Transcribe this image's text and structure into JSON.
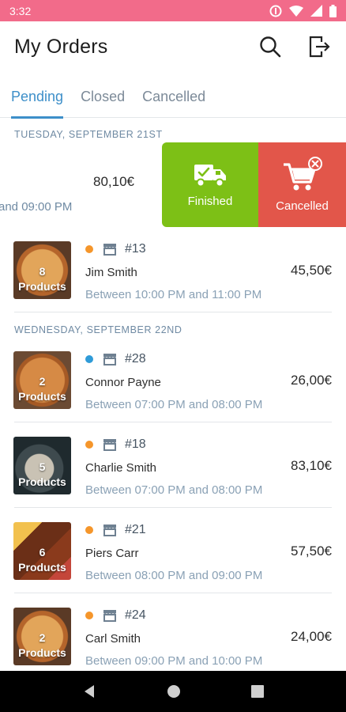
{
  "status_bar": {
    "time": "3:32"
  },
  "header": {
    "title": "My Orders"
  },
  "tabs": [
    {
      "label": "Pending",
      "active": true
    },
    {
      "label": "Closed",
      "active": false
    },
    {
      "label": "Cancelled",
      "active": false
    }
  ],
  "sections": [
    {
      "date": "TUESDAY, SEPTEMBER 21ST"
    },
    {
      "date": "WEDNESDAY, SEPTEMBER 22ND"
    }
  ],
  "swiped_order": {
    "price": "80,10€",
    "time": "and 09:00 PM",
    "actions": {
      "finished": "Finished",
      "cancelled": "Cancelled"
    }
  },
  "orders": [
    {
      "count": "8",
      "products_label": "Products",
      "number": "#13",
      "name": "Jim Smith",
      "time": "Between 10:00 PM and 11:00 PM",
      "price": "45,50€",
      "dot_color": "#f5962b"
    },
    {
      "count": "2",
      "products_label": "Products",
      "number": "#28",
      "name": "Connor Payne",
      "time": "Between 07:00 PM and 08:00 PM",
      "price": "26,00€",
      "dot_color": "#2f9bd8"
    },
    {
      "count": "5",
      "products_label": "Products",
      "number": "#18",
      "name": "Charlie Smith",
      "time": "Between 07:00 PM and 08:00 PM",
      "price": "83,10€",
      "dot_color": "#f5962b"
    },
    {
      "count": "6",
      "products_label": "Products",
      "number": "#21",
      "name": "Piers Carr",
      "time": "Between 08:00 PM and 09:00 PM",
      "price": "57,50€",
      "dot_color": "#f5962b"
    },
    {
      "count": "2",
      "products_label": "Products",
      "number": "#24",
      "name": "Carl Smith",
      "time": "Between 09:00 PM and 10:00 PM",
      "price": "24,00€",
      "dot_color": "#f5962b"
    }
  ],
  "colors": {
    "status_bar": "#f26b8a",
    "accent": "#3d8fc9",
    "finished": "#7dc016",
    "cancelled": "#e2564a"
  },
  "icons": [
    "signal-icon",
    "wifi-icon",
    "battery-icon",
    "search-icon",
    "logout-icon",
    "delivery-truck-icon",
    "cart-cancel-icon",
    "store-icon",
    "back-icon",
    "home-icon",
    "recents-icon"
  ]
}
